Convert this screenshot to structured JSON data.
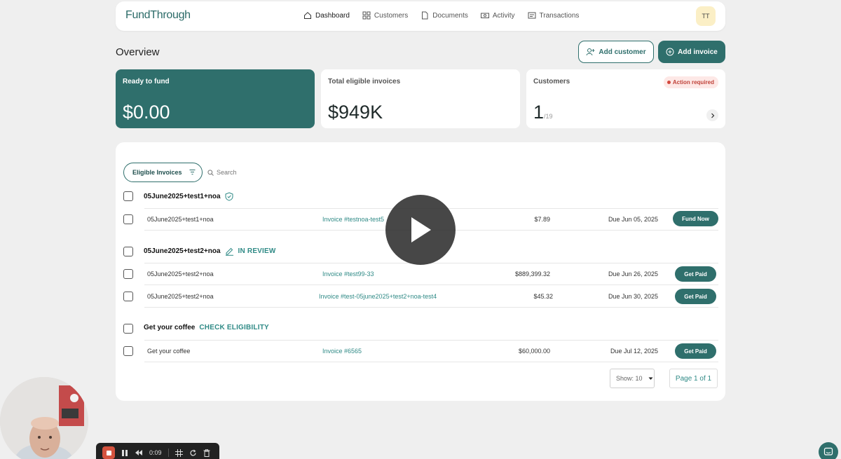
{
  "header": {
    "logo": "FundThrough",
    "nav": [
      {
        "label": "Dashboard",
        "icon": "home-icon",
        "active": true
      },
      {
        "label": "Customers",
        "icon": "grid-icon",
        "active": false
      },
      {
        "label": "Documents",
        "icon": "document-icon",
        "active": false
      },
      {
        "label": "Activity",
        "icon": "cash-icon",
        "active": false
      },
      {
        "label": "Transactions",
        "icon": "receipt-icon",
        "active": false
      }
    ],
    "avatar_initials": "TT"
  },
  "page": {
    "title": "Overview",
    "add_customer_label": "Add customer",
    "add_invoice_label": "Add invoice"
  },
  "cards": {
    "ready": {
      "label": "Ready to fund",
      "value": "$0.00"
    },
    "eligible": {
      "label": "Total eligible invoices",
      "value": "$949K"
    },
    "customers": {
      "label": "Customers",
      "badge": "Action required",
      "value": "1",
      "total": "/19"
    }
  },
  "invoices": {
    "filter_label": "Eligible Invoices",
    "search_placeholder": "Search",
    "groups": [
      {
        "name": "05June2025+test1+noa",
        "status": "",
        "status_icon": "shield-check-icon",
        "rows": [
          {
            "customer": "05June2025+test1+noa",
            "invoice": "Invoice #testnoa-test5",
            "amount": "$7.89",
            "due": "Due Jun 05, 2025",
            "action": "Fund Now"
          }
        ]
      },
      {
        "name": "05June2025+test2+noa",
        "status": "IN REVIEW",
        "status_icon": "pencil-icon",
        "rows": [
          {
            "customer": "05June2025+test2+noa",
            "invoice": "Invoice #test99-33",
            "amount": "$889,399.32",
            "due": "Due Jun 26, 2025",
            "action": "Get Paid"
          },
          {
            "customer": "05June2025+test2+noa",
            "invoice": "Invoice #test-05june2025+test2+noa-test4",
            "amount": "$45.32",
            "due": "Due Jun 30, 2025",
            "action": "Get Paid"
          }
        ]
      },
      {
        "name": "Get your coffee",
        "status": "CHECK ELIGIBILITY",
        "rows": [
          {
            "customer": "Get your coffee",
            "invoice": "Invoice #6565",
            "amount": "$60,000.00",
            "due": "Due Jul 12, 2025",
            "action": "Get Paid"
          }
        ]
      }
    ],
    "show_label": "Show: 10",
    "page_label": "Page 1 of 1"
  },
  "recorder": {
    "time": "0:09"
  },
  "colors": {
    "brand": "#2f6f6c",
    "accent_text": "#2f8a86",
    "badge_red": "#c0433a"
  }
}
